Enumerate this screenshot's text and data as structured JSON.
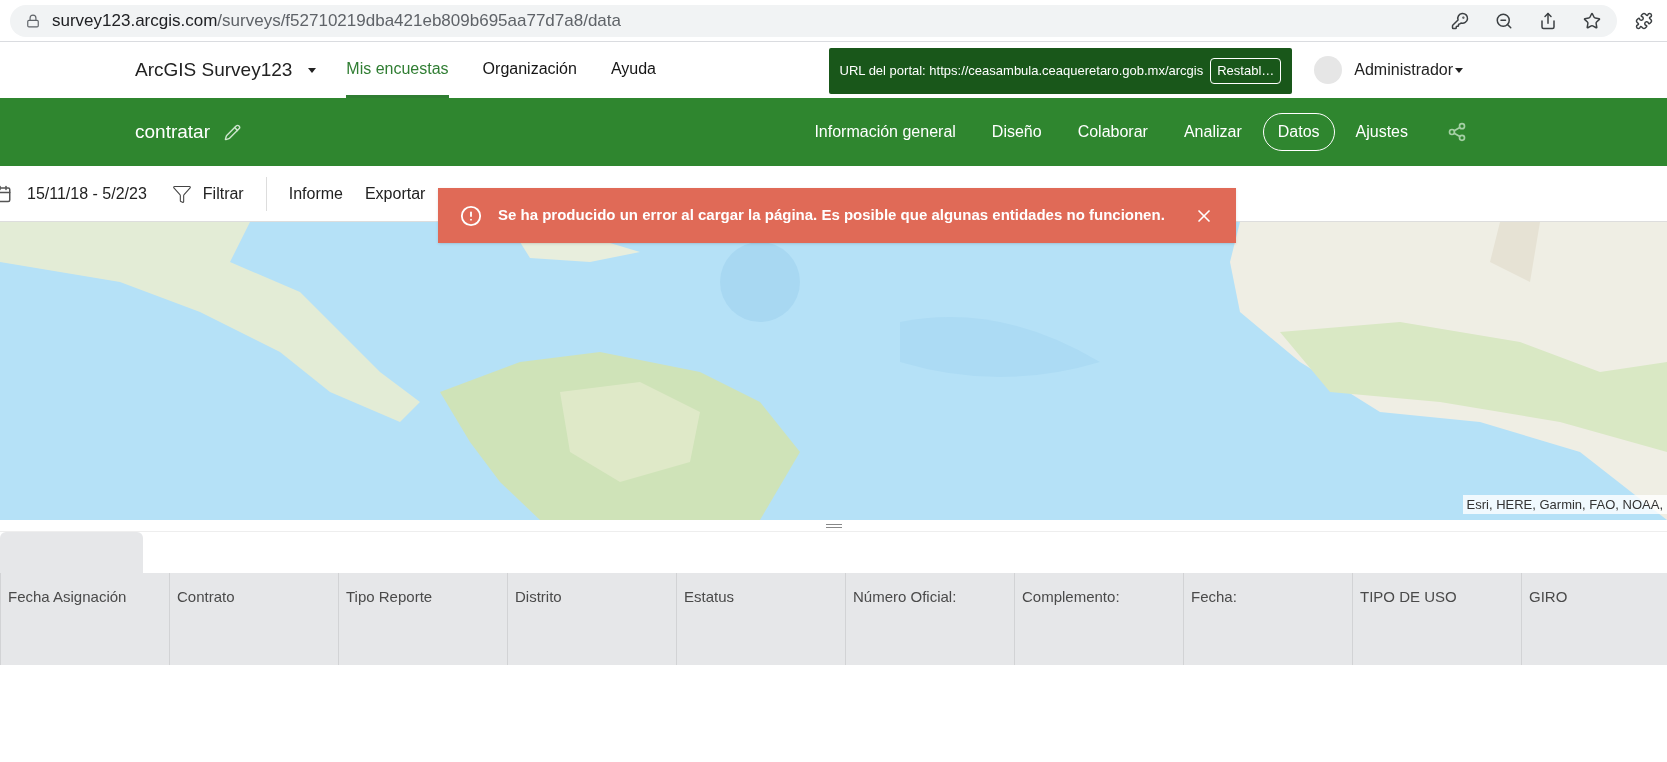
{
  "browser": {
    "url_host": "survey123.arcgis.com",
    "url_path": "/surveys/f52710219dba421eb809b695aa77d7a8/data"
  },
  "header": {
    "app_name": "ArcGIS Survey123",
    "user": "Administrador"
  },
  "nav": [
    {
      "label": "Mis encuestas",
      "selected": true
    },
    {
      "label": "Organización",
      "selected": false
    },
    {
      "label": "Ayuda",
      "selected": false
    }
  ],
  "portal": {
    "label": "URL del portal: https://ceasambula.ceaqueretaro.gob.mx/arcgis",
    "button": "Restabl…"
  },
  "survey": {
    "title": "contratar"
  },
  "survey_tabs": [
    {
      "label": "Información general",
      "selected": false
    },
    {
      "label": "Diseño",
      "selected": false
    },
    {
      "label": "Colaborar",
      "selected": false
    },
    {
      "label": "Analizar",
      "selected": false
    },
    {
      "label": "Datos",
      "selected": true
    },
    {
      "label": "Ajustes",
      "selected": false
    }
  ],
  "toolbar": {
    "date_range": "15/11/18 - 5/2/23",
    "filter": "Filtrar",
    "actions": [
      "Informe",
      "Exportar"
    ]
  },
  "toast": {
    "message": "Se ha producido un error al cargar la página. Es posible que algunas entidades no funcionen."
  },
  "map": {
    "attribution": "Esri, HERE, Garmin, FAO, NOAA,"
  },
  "table": {
    "columns": [
      "Fecha Asignación",
      "Contrato",
      "Tipo Reporte",
      "Distrito",
      "Estatus",
      "Número Oficial:",
      "Complemento:",
      "Fecha:",
      "TIPO DE USO",
      "GIRO"
    ]
  }
}
